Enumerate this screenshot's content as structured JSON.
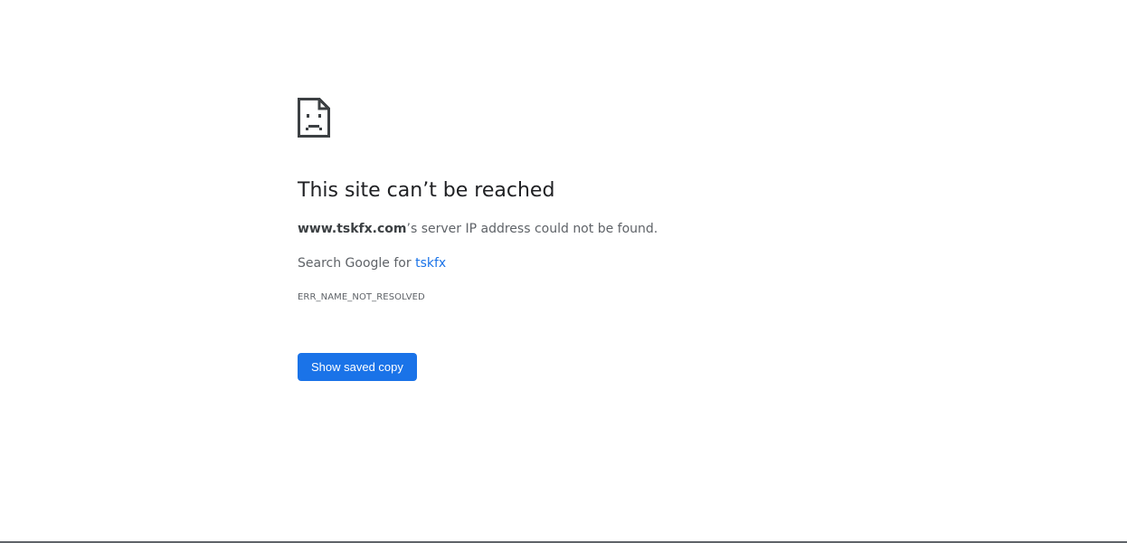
{
  "error_page": {
    "icon": "sad-page-icon",
    "title": "This site can’t be reached",
    "domain": "www.tskfx.com",
    "server_message_suffix": "’s server IP address could not be found.",
    "search_prefix": "Search Google for ",
    "search_term": "tskfx",
    "error_code": "ERR_NAME_NOT_RESOLVED",
    "button_label": "Show saved copy"
  },
  "colors": {
    "accent": "#1a73e8",
    "text_primary": "#202124",
    "text_secondary": "#5f6368"
  }
}
